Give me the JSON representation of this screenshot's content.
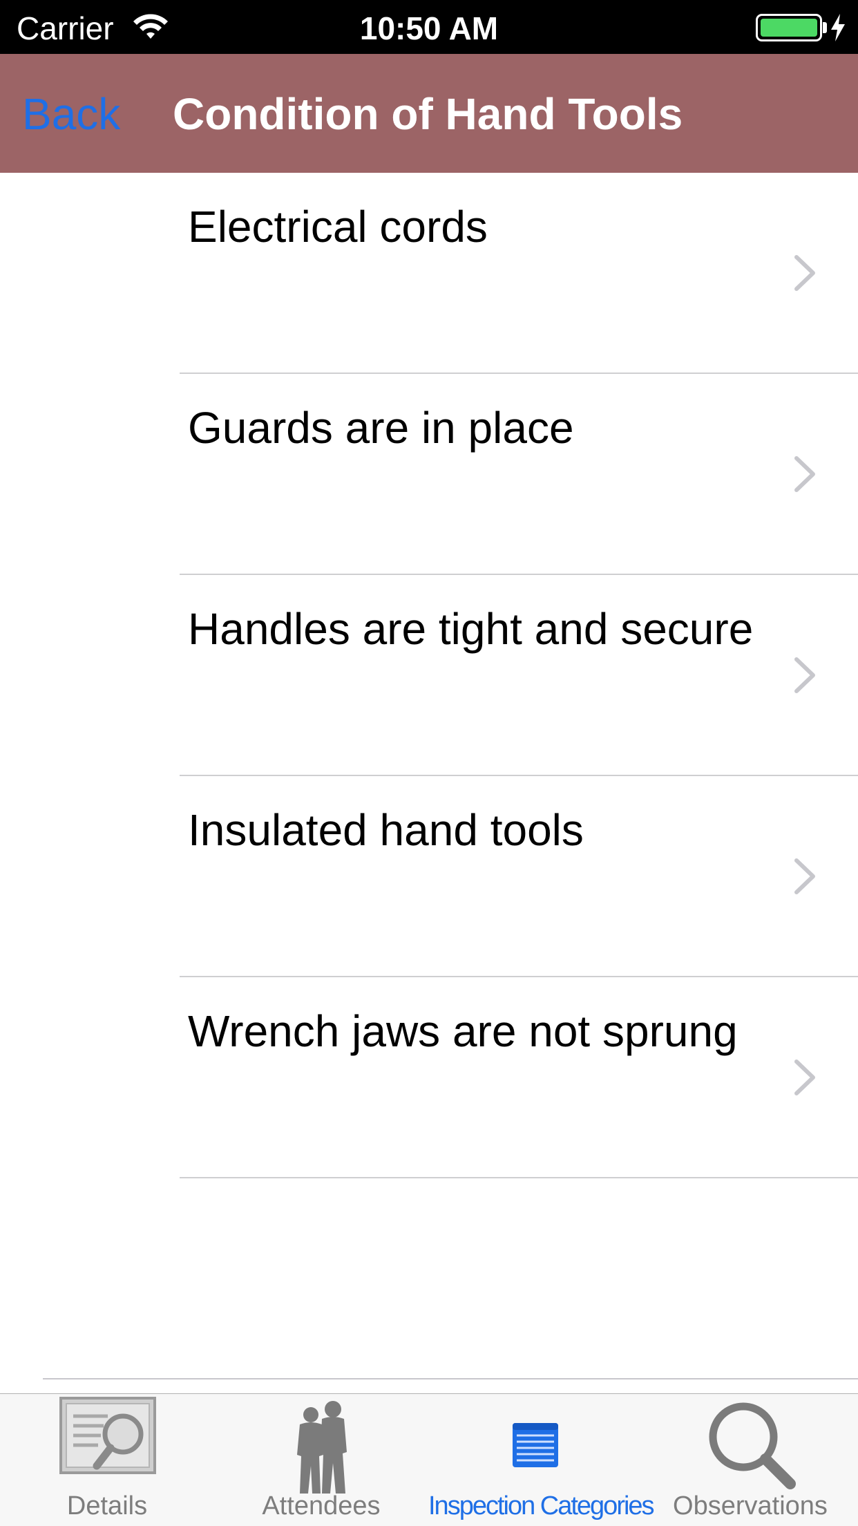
{
  "status_bar": {
    "carrier": "Carrier",
    "time": "10:50 AM",
    "battery_color": "#4cd964"
  },
  "nav": {
    "back_label": "Back",
    "title": "Condition of Hand Tools",
    "background_color": "#9c6466",
    "accent_color": "#1f6fe6"
  },
  "items": [
    {
      "label": "Electrical cords"
    },
    {
      "label": "Guards are in place"
    },
    {
      "label": "Handles are tight and secure"
    },
    {
      "label": "Insulated hand tools"
    },
    {
      "label": "Wrench jaws are not sprung"
    }
  ],
  "tabs": [
    {
      "label": "Details",
      "icon": "details-magnifier-icon",
      "active": false
    },
    {
      "label": "Attendees",
      "icon": "attendees-silhouette-icon",
      "active": false
    },
    {
      "label": "Inspection Categories",
      "icon": "list-icon",
      "active": true
    },
    {
      "label": "Observations",
      "icon": "search-icon",
      "active": false
    }
  ]
}
